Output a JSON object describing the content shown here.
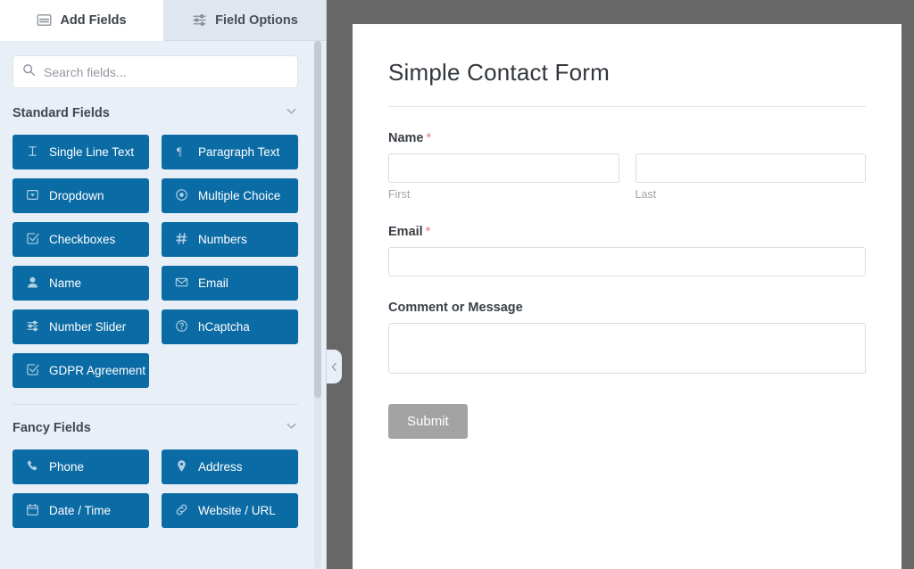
{
  "sidebar": {
    "tabs": [
      {
        "label": "Add Fields",
        "icon": "panel-icon",
        "active": true
      },
      {
        "label": "Field Options",
        "icon": "sliders-icon",
        "active": false
      }
    ],
    "search": {
      "placeholder": "Search fields...",
      "value": "",
      "icon": "search-icon"
    },
    "sections": [
      {
        "title": "Standard Fields",
        "collapse_icon": "chevron-down-icon",
        "fields": [
          {
            "label": "Single Line Text",
            "icon": "text-cursor-icon"
          },
          {
            "label": "Paragraph Text",
            "icon": "paragraph-icon"
          },
          {
            "label": "Dropdown",
            "icon": "dropdown-icon"
          },
          {
            "label": "Multiple Choice",
            "icon": "radio-icon"
          },
          {
            "label": "Checkboxes",
            "icon": "checkbox-icon"
          },
          {
            "label": "Numbers",
            "icon": "hash-icon"
          },
          {
            "label": "Name",
            "icon": "user-icon"
          },
          {
            "label": "Email",
            "icon": "envelope-icon"
          },
          {
            "label": "Number Slider",
            "icon": "sliders-icon"
          },
          {
            "label": "hCaptcha",
            "icon": "question-circle-icon"
          },
          {
            "label": "GDPR Agreement",
            "icon": "checkbox-icon"
          }
        ]
      },
      {
        "title": "Fancy Fields",
        "collapse_icon": "chevron-down-icon",
        "fields": [
          {
            "label": "Phone",
            "icon": "phone-icon"
          },
          {
            "label": "Address",
            "icon": "map-pin-icon"
          },
          {
            "label": "Date / Time",
            "icon": "calendar-icon"
          },
          {
            "label": "Website / URL",
            "icon": "link-icon"
          }
        ]
      }
    ]
  },
  "collapse_handle": {
    "icon": "chevron-left-icon"
  },
  "preview": {
    "form_title": "Simple Contact Form",
    "fields": [
      {
        "label": "Name",
        "required": true,
        "required_mark": "*",
        "type": "name",
        "inputs": [
          {
            "sublabel": "First",
            "value": "",
            "placeholder": ""
          },
          {
            "sublabel": "Last",
            "value": "",
            "placeholder": ""
          }
        ]
      },
      {
        "label": "Email",
        "required": true,
        "required_mark": "*",
        "type": "text",
        "inputs": [
          {
            "sublabel": "",
            "value": "",
            "placeholder": ""
          }
        ]
      },
      {
        "label": "Comment or Message",
        "required": false,
        "required_mark": "",
        "type": "textarea",
        "inputs": [
          {
            "sublabel": "",
            "value": "",
            "placeholder": ""
          }
        ]
      }
    ],
    "submit_label": "Submit"
  },
  "colors": {
    "field_button_blue": "#0b6ba5",
    "sidebar_bg": "#e9eff7",
    "preview_backdrop": "#666766",
    "required_red": "#e27c7c",
    "submit_gray": "#a3a3a3"
  }
}
